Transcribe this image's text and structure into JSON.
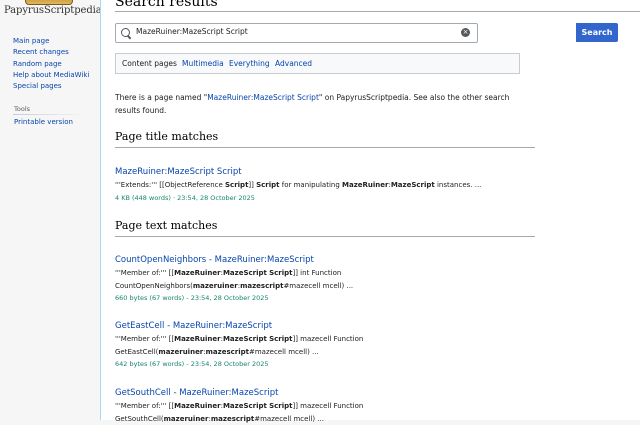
{
  "logo": {
    "wordmark": "PapyrusScriptpedia"
  },
  "sidebar": {
    "navigation": [
      "Main page",
      "Recent changes",
      "Random page",
      "Help about MediaWiki",
      "Special pages"
    ],
    "tools_heading": "Tools",
    "tools": [
      "Printable version"
    ]
  },
  "page": {
    "title": "Search results"
  },
  "search": {
    "value": "MazeRuiner:MazeScript Script",
    "button_label": "Search"
  },
  "filters": [
    "Content pages",
    "Multimedia",
    "Everything",
    "Advanced"
  ],
  "info": {
    "prefix": "There is a page named \"",
    "link": "MazeRuiner:MazeScript Script",
    "suffix": "\" on PapyrusScriptpedia. See also the other search results found."
  },
  "sections": {
    "title_matches": "Page title matches",
    "text_matches": "Page text matches"
  },
  "title_results": [
    {
      "title": "MazeRuiner:MazeScript Script",
      "snippet": "'''Extends:''' [[ObjectReference <b>Script</b>]] <b>Script</b> for manipulating <b>MazeRuiner</b>:<b>MazeScript</b> instances. ...",
      "meta": "4 KB (448 words) · 23:54, 28 October 2025"
    }
  ],
  "text_results": [
    {
      "title": "CountOpenNeighbors - MazeRuiner:MazeScript",
      "snippet": "'''Member of:''' [[<b>MazeRuiner</b>:<b>MazeScript</b> <b>Script</b>]] int Function CountOpenNeighbors(<b>mazeruiner</b>:<b>mazescript</b>#mazecell mcell) ...",
      "meta": "660 bytes (67 words) - 23:54, 28 October 2025"
    },
    {
      "title": "GetEastCell - MazeRuiner:MazeScript",
      "snippet": "'''Member of:''' [[<b>MazeRuiner</b>:<b>MazeScript</b> <b>Script</b>]] mazecell Function GetEastCell(<b>mazeruiner</b>:<b>mazescript</b>#mazecell mcell) ...",
      "meta": "642 bytes (67 words) - 23:54, 28 October 2025"
    },
    {
      "title": "GetSouthCell - MazeRuiner:MazeScript",
      "snippet": "'''Member of:''' [[<b>MazeRuiner</b>:<b>MazeScript</b> <b>Script</b>]] mazecell Function GetSouthCell(<b>mazeruiner</b>:<b>mazescript</b>#mazecell mcell) ...",
      "meta": ""
    }
  ]
}
